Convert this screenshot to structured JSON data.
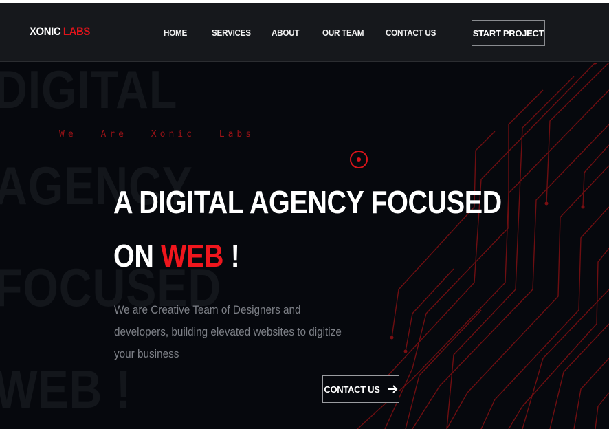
{
  "brand": {
    "name": "XONIC",
    "accent": "LABS"
  },
  "nav": {
    "items": [
      {
        "label": "HOME"
      },
      {
        "label": "SERVICES"
      },
      {
        "label": "ABOUT"
      },
      {
        "label": "OUR TEAM"
      },
      {
        "label": "CONTACT US"
      }
    ],
    "cta_label": "START PROJECT"
  },
  "hero": {
    "background_words": [
      "DIGITAL",
      "AGENCY",
      "FOCUSED",
      "WEB !"
    ],
    "eyebrow": "We Are Xonic Labs",
    "headline_line1": "A DIGITAL AGENCY FOCUSED",
    "headline_line2_prefix": "ON",
    "headline_highlight": "WEB",
    "headline_line2_suffix": "!",
    "description": "We are Creative Team of Designers and developers, building elevated websites to digitize your business",
    "cta_label": "CONTACT US"
  },
  "icons": {
    "hero_cta": "arrow-right-icon",
    "hero_marker": "target-icon"
  },
  "colors": {
    "accent": "#e0141b",
    "background": "#06080d",
    "navbar": "#16181c",
    "circuit": "#7a0f12"
  }
}
